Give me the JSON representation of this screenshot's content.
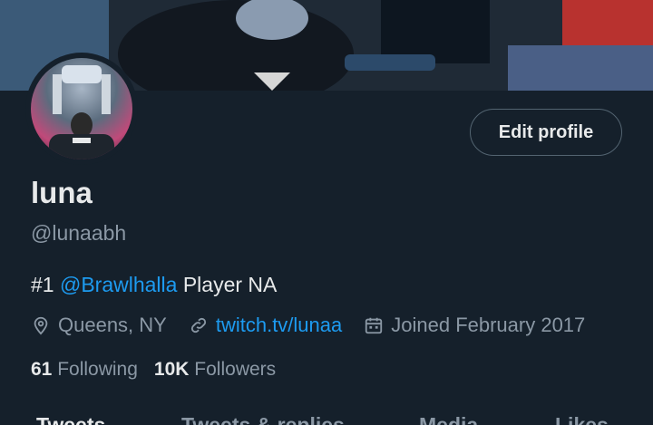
{
  "profile": {
    "name": "luna",
    "handle": "@lunaabh",
    "bio_prefix": "#1 ",
    "bio_mention": "@Brawlhalla",
    "bio_suffix": " Player NA",
    "location": "Queens, NY",
    "website": "twitch.tv/lunaa",
    "joined": "Joined February 2017",
    "following_count": "61",
    "following_label": "Following",
    "followers_count": "10K",
    "followers_label": "Followers"
  },
  "actions": {
    "edit_profile_label": "Edit profile"
  },
  "tabs": [
    {
      "label": "Tweets"
    },
    {
      "label": "Tweets & replies"
    },
    {
      "label": "Media"
    },
    {
      "label": "Likes"
    }
  ],
  "colors": {
    "background": "#15202b",
    "accent": "#1d9bf0",
    "secondary_text": "#8b98a5"
  },
  "icons": {
    "location": "location-pin-icon",
    "link": "link-icon",
    "calendar": "calendar-icon"
  }
}
